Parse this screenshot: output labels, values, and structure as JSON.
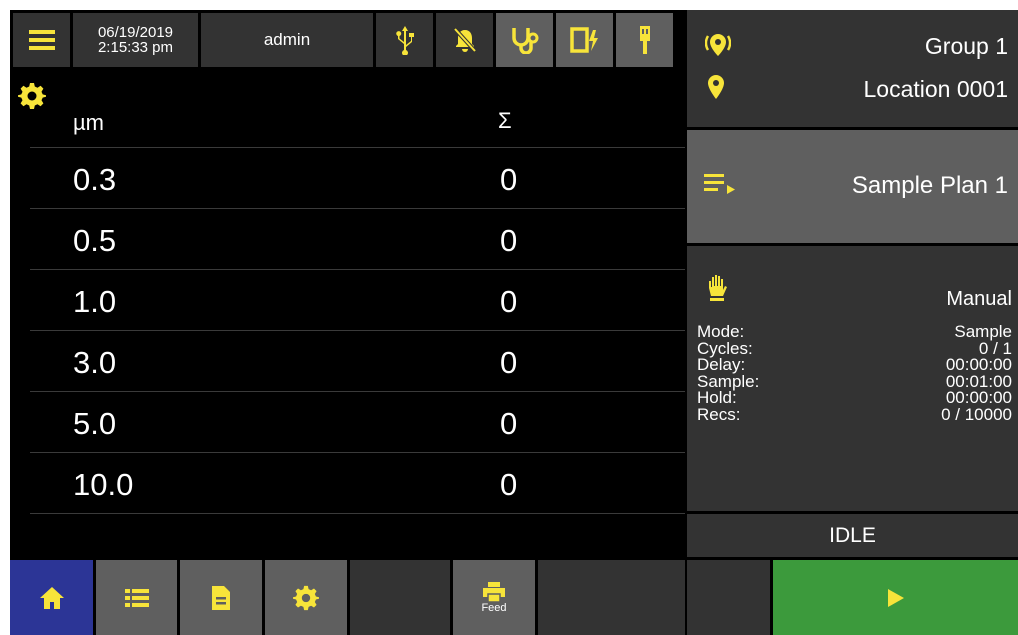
{
  "topbar": {
    "date": "06/19/2019",
    "time": "2:15:33 pm",
    "user": "admin",
    "icons": [
      "menu-icon",
      "usb-icon",
      "bell-off-icon",
      "stethoscope-icon",
      "battery-charging-icon",
      "probe-icon"
    ]
  },
  "table": {
    "header_size": "µm",
    "header_sum": "Σ",
    "rows": [
      {
        "size": "0.3",
        "count": "0"
      },
      {
        "size": "0.5",
        "count": "0"
      },
      {
        "size": "1.0",
        "count": "0"
      },
      {
        "size": "3.0",
        "count": "0"
      },
      {
        "size": "5.0",
        "count": "0"
      },
      {
        "size": "10.0",
        "count": "0"
      }
    ]
  },
  "location": {
    "group": "Group 1",
    "location": "Location 0001"
  },
  "plan": {
    "name": "Sample Plan 1"
  },
  "info": {
    "mode_type": "Manual",
    "rows": [
      {
        "label": "Mode:",
        "value": "Sample"
      },
      {
        "label": "Cycles:",
        "value": "0 / 1"
      },
      {
        "label": "Delay:",
        "value": "00:00:00"
      },
      {
        "label": "Sample:",
        "value": "00:01:00"
      },
      {
        "label": "Hold:",
        "value": "00:00:00"
      },
      {
        "label": "Recs:",
        "value": "0 / 10000"
      }
    ]
  },
  "status": "IDLE",
  "bottom_nav": {
    "feed_label": "Feed"
  },
  "colors": {
    "accent_yellow": "#f7e43a",
    "home_blue": "#2c3596",
    "start_green": "#3c9a3c",
    "panel_dark": "#333333",
    "panel_light": "#5f5f5f"
  }
}
